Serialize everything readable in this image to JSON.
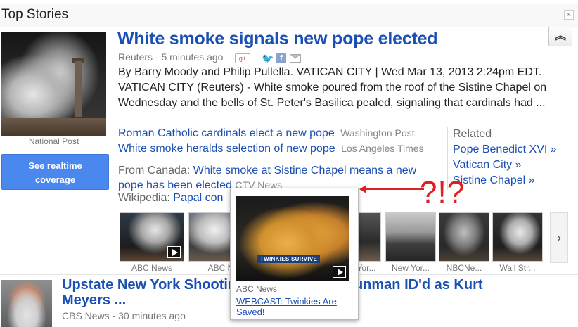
{
  "section": {
    "title": "Top Stories",
    "collapse_all": "»"
  },
  "story": {
    "headline": "White smoke signals new pope elected",
    "source": "Reuters",
    "time": "5 minutes ago",
    "share_icons": [
      "gplus-icon",
      "twitter-icon",
      "facebook-icon",
      "email-icon"
    ],
    "image_credit": "National Post",
    "snippet": "By Barry Moody and Philip Pullella. VATICAN CITY | Wed Mar 13, 2013 2:24pm EDT. VATICAN CITY (Reuters) - White smoke poured from the roof of the Sistine Chapel on Wednesday and the bells of St. Peter's Basilica pealed, signaling that cardinals had ...",
    "realtime_button": [
      "See realtime",
      "coverage"
    ],
    "collapse": "⌃",
    "related_articles": [
      {
        "title": "Roman Catholic cardinals elect a new pope",
        "source": "Washington Post"
      },
      {
        "title": "White smoke heralds selection of new pope",
        "source": "Los Angeles Times"
      }
    ],
    "canada": {
      "prefix": "From Canada:",
      "title": "White smoke at Sistine Chapel means a new pope has been elected",
      "source": "CTV News"
    },
    "wikipedia": {
      "prefix": "Wikipedia:",
      "title": "Papal con"
    },
    "related": {
      "title": "Related",
      "items": [
        "Pope Benedict XVI »",
        "Vatican City »",
        "Sistine Chapel »"
      ]
    },
    "videos": [
      {
        "label": "ABC News",
        "play": true
      },
      {
        "label": "ABC N",
        "play": false
      },
      {
        "label": "",
        "play": false
      },
      {
        "label": "",
        "play": false
      },
      {
        "label": "Wall Str...",
        "play": false
      }
    ],
    "video_labels_right": [
      "Yor...",
      "New Yor...",
      "NBCNe...",
      "Wall Str..."
    ],
    "next": "›"
  },
  "annotation": {
    "text": "?!?"
  },
  "popup": {
    "banner": "TWINKIES SURVIVE",
    "source": "ABC News",
    "link": "WEBCAST: Twinkies Are Saved!"
  },
  "story2": {
    "headline": "Upstate New York Shooting Spree ... ted gunman ID'd as Kurt Meyers ...",
    "headline_left": "Upstate New York Shootin",
    "headline_right": "ted gunman ID'd as Kurt",
    "headline_line2": "Meyers ...",
    "source": "CBS News",
    "time": "30 minutes ago"
  },
  "colors": {
    "link": "#1a4fb4",
    "button": "#4a87ee",
    "annotation": "#e02020"
  }
}
